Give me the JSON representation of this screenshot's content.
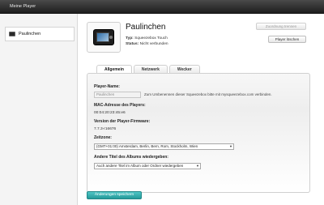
{
  "window": {
    "title": "Meine Player"
  },
  "sidebar": {
    "items": [
      {
        "label": "Paulinchen",
        "icon": "squeezebox-icon"
      }
    ]
  },
  "player": {
    "name": "Paulinchen",
    "type_label": "Typ:",
    "type_value": "Squeezebox Touch",
    "status_label": "Status:",
    "status_value": "Nicht verbunden"
  },
  "buttons": {
    "disconnect": "Zuordnung trennen",
    "delete": "Player löschen",
    "save": "Änderungen speichern"
  },
  "tabs": [
    {
      "label": "Allgemein"
    },
    {
      "label": "Netzwerk"
    },
    {
      "label": "Wecker"
    }
  ],
  "form": {
    "name_label": "Player-Name:",
    "name_value": "Paulinchen",
    "name_hint": "Zum Umbenennen dieser Squeezebox bitte mit mysqueezebox.com verbinden.",
    "mac_label": "MAC-Adresse des Players:",
    "mac_value": "00:04:20:23:45:e6",
    "firmware_label": "Version der Player-Firmware:",
    "firmware_value": "7.7.3-r16676",
    "timezone_label": "Zeitzone:",
    "timezone_value": "(GMT+01:00) Amsterdam, Berlin, Bern, Rom, Stockholm, Wien",
    "album_label": "Andere Titel des Albums wiedergeben:",
    "album_value": "Auch andere Titel im Album oder Ordner wiedergeben"
  }
}
